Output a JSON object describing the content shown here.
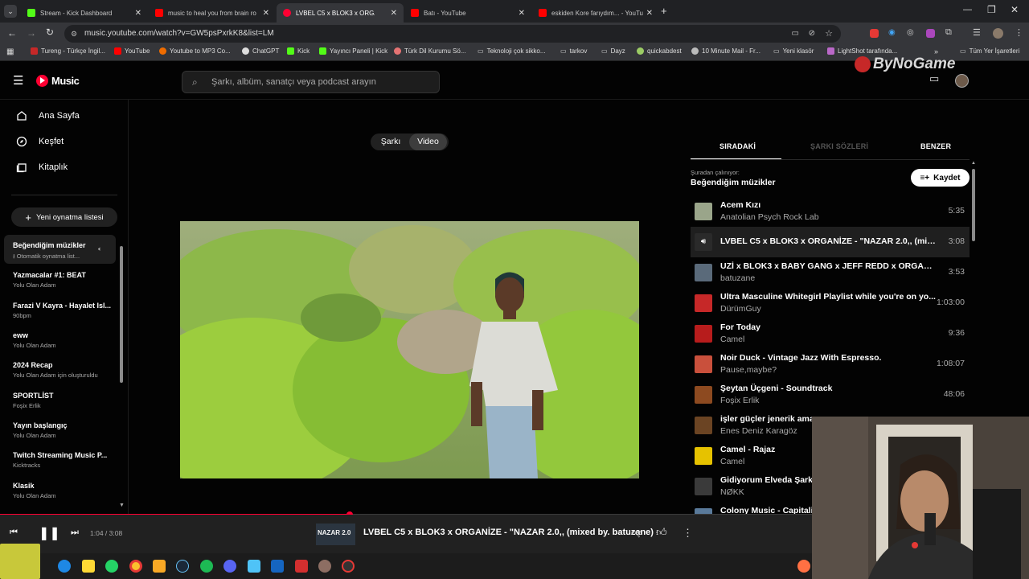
{
  "browser": {
    "tabs": [
      {
        "title": "Stream - Kick Dashboard",
        "color": "#53fc18"
      },
      {
        "title": "music to heal you from brain ro",
        "color": "#ff0000"
      },
      {
        "title": "LVBEL C5 x BLOK3 x ORGAN",
        "color": "#ff0033"
      },
      {
        "title": "Batı - YouTube",
        "color": "#ff0000"
      },
      {
        "title": "eskiden Kore farıydım... - YouTu",
        "color": "#ff0000"
      }
    ],
    "url": "music.youtube.com/watch?v=GW5psPxrkK8&list=LM",
    "bookmarks": [
      "Tureng - Türkçe İngil...",
      "YouTube",
      "Youtube to MP3 Co...",
      "ChatGPT",
      "Kick",
      "Yayıncı Paneli | Kick",
      "Türk Dil Kurumu Sö...",
      "Teknoloji çok sikko...",
      "tarkov",
      "Dayz",
      "quickabdest",
      "10 Minute Mail - Fr...",
      "Yeni klasör",
      "LightShot tarafında...",
      "Tüm Yer İşaretleri"
    ],
    "watermark": "ByNoGame"
  },
  "header": {
    "logo": "Music",
    "search_placeholder": "Şarkı, albüm, sanatçı veya podcast arayın"
  },
  "sidebar": {
    "nav": [
      "Ana Sayfa",
      "Keşfet",
      "Kitaplık"
    ],
    "new_playlist": "Yeni oynatma listesi",
    "playlists": [
      {
        "title": "Beğendiğim müzikler",
        "subtitle": "Otomatik oynatma list..."
      },
      {
        "title": "Yazmacalar #1: BEAT",
        "subtitle": "Yolu Olan Adam"
      },
      {
        "title": "Farazi V Kayra - Hayalet Isl...",
        "subtitle": "90bpm"
      },
      {
        "title": "eww",
        "subtitle": "Yolu Olan Adam"
      },
      {
        "title": "2024 Recap",
        "subtitle": "Yolu Olan Adam için oluşturuldu"
      },
      {
        "title": "SPORTLİST",
        "subtitle": "Foşix Erlik"
      },
      {
        "title": "Yayın başlangıç",
        "subtitle": "Yolu Olan Adam"
      },
      {
        "title": "Twitch Streaming Music P...",
        "subtitle": "Kicktracks"
      },
      {
        "title": "Klasik",
        "subtitle": "Yolu Olan Adam"
      }
    ]
  },
  "main": {
    "toggle": {
      "song": "Şarkı",
      "video": "Video"
    }
  },
  "right_panel": {
    "tabs": [
      "SIRADAKİ",
      "ŞARKI SÖZLERİ",
      "BENZER"
    ],
    "playing_from_label": "Şuradan çalınıyor:",
    "playing_from": "Beğendiğim müzikler",
    "save_label": "Kaydet",
    "queue": [
      {
        "title": "Acem Kızı",
        "artist": "Anatolian Psych Rock Lab",
        "duration": "5:35",
        "color": "#9aa58a"
      },
      {
        "title": "LVBEL C5 x BLOK3 x ORGANİZE - \"NAZAR 2.0,, (mixed ...",
        "artist": "",
        "duration": "3:08",
        "color": "#2a2a2a"
      },
      {
        "title": "UZİ x BLOK3 x BABY GANG x JEFF REDD x ORGANİZE ...",
        "artist": "batuzane",
        "duration": "3:53",
        "color": "#5a6a7a"
      },
      {
        "title": "Ultra Masculine Whitegirl Playlist while you're on yo...",
        "artist": "DürümGuy",
        "duration": "1:03:00",
        "color": "#c62828"
      },
      {
        "title": "For Today",
        "artist": "Camel",
        "duration": "9:36",
        "color": "#b71c1c"
      },
      {
        "title": "Noir Duck - Vintage Jazz With Espresso.",
        "artist": "Pause,maybe?",
        "duration": "1:08:07",
        "color": "#c9503c"
      },
      {
        "title": "Şeytan Üçgeni - Soundtrack",
        "artist": "Foşix Erlik",
        "duration": "48:06",
        "color": "#8d4a20"
      },
      {
        "title": "işler güçler jenerik ama",
        "artist": "Enes Deniz Karagöz",
        "duration": "",
        "color": "#6b4423"
      },
      {
        "title": "Camel - Rajaz",
        "artist": "Camel",
        "duration": "",
        "color": "#e6c200"
      },
      {
        "title": "Gidiyorum Elveda Şarkıs",
        "artist": "NØKK",
        "duration": "",
        "color": "#3a3a3a"
      },
      {
        "title": "Colony Music - Capitalis",
        "artist": "",
        "duration": "",
        "color": "#5a7a9a"
      }
    ]
  },
  "player": {
    "time": "1:04 / 3:08",
    "progress": 0.34,
    "thumb_text": "NAZAR 2.0",
    "title": "LVBEL C5 x BLOK3 x ORGANİZE - \"NAZAR 2.0,, (mixed by. batuzane)"
  },
  "colors": {
    "accent": "#ff0033",
    "background": "#030303",
    "player_bar": "#212121"
  }
}
